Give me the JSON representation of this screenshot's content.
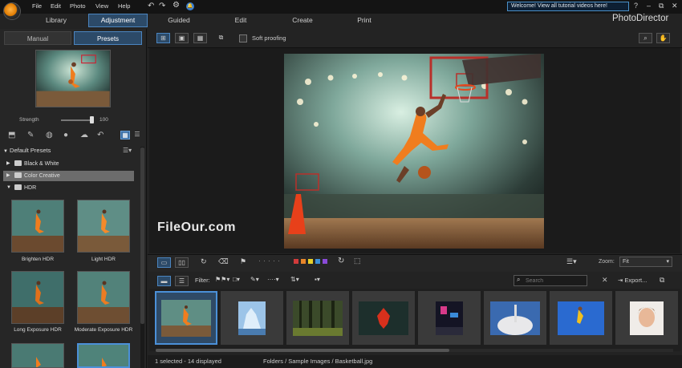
{
  "menu": [
    "File",
    "Edit",
    "Photo",
    "View",
    "Help"
  ],
  "tutorial_banner": "Welcome! View all tutorial videos here!",
  "window_controls": {
    "help": "?",
    "minimize": "–",
    "restore": "⧉",
    "close": "✕"
  },
  "mode_tabs": {
    "library": "Library",
    "adjustment": "Adjustment",
    "guided": "Guided",
    "edit": "Edit",
    "create": "Create",
    "print": "Print"
  },
  "app_name": "PhotoDirector",
  "panel_tabs": {
    "manual": "Manual",
    "presets": "Presets"
  },
  "strength": {
    "label": "Strength",
    "value": "100",
    "fraction": 1.0
  },
  "presets": {
    "group": "Default Presets",
    "folders": [
      {
        "name": "Black & White",
        "expanded": false,
        "selected": false
      },
      {
        "name": "Color Creative",
        "expanded": false,
        "selected": true
      },
      {
        "name": "HDR",
        "expanded": true,
        "selected": false
      }
    ],
    "items": [
      {
        "label": "Brighten HDR"
      },
      {
        "label": "Light HDR"
      },
      {
        "label": "Long Exposure HDR"
      },
      {
        "label": "Moderate Exposure HDR"
      },
      {
        "label": ""
      },
      {
        "label": ""
      }
    ]
  },
  "toolbar": {
    "soft_proofing": "Soft proofing"
  },
  "zoom": {
    "label": "Zoom:",
    "value": "Fit"
  },
  "filter": {
    "label": "Filter:"
  },
  "search": {
    "placeholder": "Search"
  },
  "export_label": "Export...",
  "watermark": "FileOur.com",
  "color_labels": [
    "#d23b3b",
    "#e8862a",
    "#e8d12a",
    "#3a8fd8",
    "#8a4ad8"
  ],
  "status": {
    "selection": "1 selected - 14 displayed",
    "path": "Folders / Sample Images / Basketball.jpg"
  },
  "filmstrip": {
    "selected_index": 0,
    "count_visible": 8
  }
}
